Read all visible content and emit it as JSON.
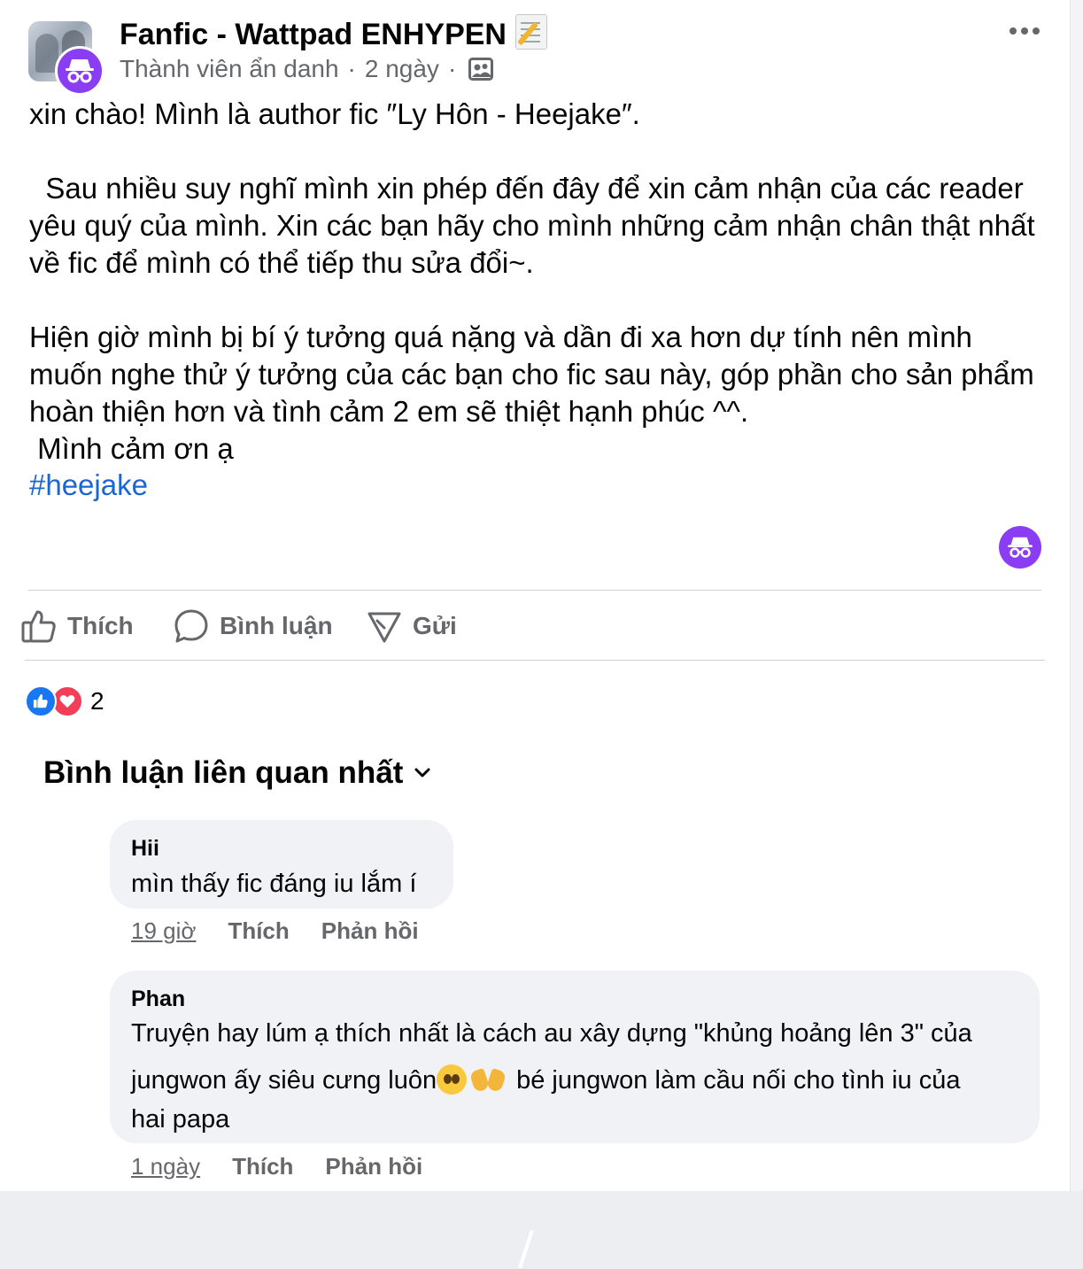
{
  "post": {
    "group_name": "Fanfic - Wattpad ENHYPEN",
    "group_emoji": "memo-icon",
    "author": "Thành viên ẩn danh",
    "time": "2 ngày",
    "audience_icon": "group-audience-icon",
    "text": "xin chào! Mình là author fic ″Ly Hôn - Heejake″.\n\n  Sau nhiều suy nghĩ mình xin phép đến đây để xin cảm nhận của các reader yêu quý của mình. Xin các bạn hãy cho mình những cảm nhận chân thật nhất về fic để mình có thể tiếp thu sửa đổi~.\n\nHiện giờ mình bị bí ý tưởng quá nặng và dần đi xa hơn dự tính nên mình muốn nghe thử ý tưởng của các bạn cho fic sau này, góp phần cho sản phẩm hoàn thiện hơn và tình cảm 2 em sẽ thiệt hạnh phúc ^^.\n Mình cảm ơn ạ",
    "hashtag": "#heejake"
  },
  "actions": {
    "like": "Thích",
    "comment": "Bình luận",
    "send": "Gửi"
  },
  "reactions": {
    "types": [
      "like",
      "love"
    ],
    "count": "2"
  },
  "comments_section": {
    "sort_label": "Bình luận liên quan nhất"
  },
  "comments": [
    {
      "author": "Hii",
      "text": "mìn thấy fic đáng iu lắm í",
      "time": "19 giờ",
      "like": "Thích",
      "reply": "Phản hồi"
    },
    {
      "author": "Phan",
      "line1": "Truyện hay lúm ạ thích nhất là cách au xây dựng \"khủng hoảng lên 3\" của",
      "line2a": "jungwon ấy siêu cưng luôn",
      "line2_emojis": [
        "pleading-face-emoji",
        "heart-hands-emoji"
      ],
      "line2b": "bé jungwon làm cầu nối cho tình iu của",
      "line3": "hai papa",
      "time": "1 ngày",
      "like": "Thích",
      "reply": "Phản hồi"
    }
  ],
  "colors": {
    "anonymous_badge": "#8a3df2",
    "hashtag": "#1b66d2",
    "like_reaction": "#1877f2",
    "love_reaction": "#f33e58",
    "secondary_text": "#65676b",
    "bubble": "#f0f2f5"
  }
}
